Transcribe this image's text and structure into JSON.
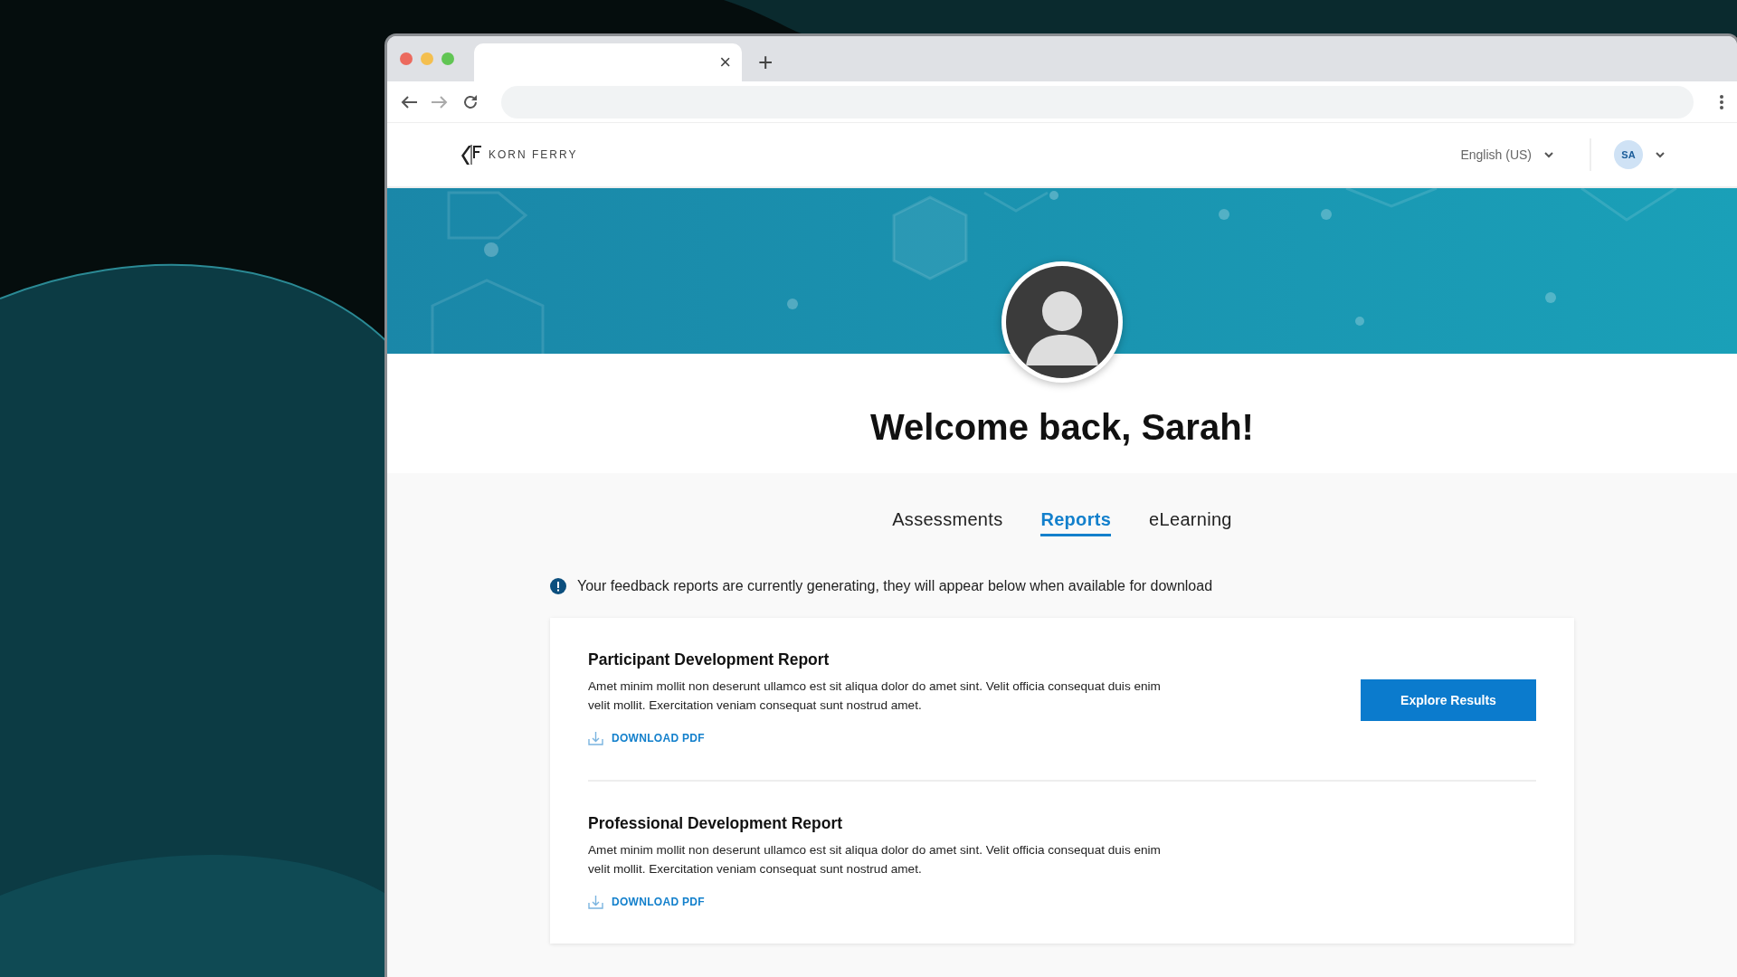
{
  "browser": {
    "tab_close": "×",
    "new_tab": "+"
  },
  "header": {
    "logo": "KORN FERRY",
    "language": "English (US)",
    "user_initials": "SA"
  },
  "welcome": "Welcome back, Sarah!",
  "tabs": [
    {
      "label": "Assessments",
      "selected": false
    },
    {
      "label": "Reports",
      "selected": true
    },
    {
      "label": "eLearning",
      "selected": false
    }
  ],
  "notice": "Your feedback reports are currently generating, they will appear below when available for download",
  "reports": [
    {
      "title": "Participant Development Report",
      "description": "Amet minim mollit non deserunt ullamco est sit aliqua dolor do amet sint. Velit officia consequat duis enim velit mollit. Exercitation veniam consequat sunt nostrud amet.",
      "download": "DOWNLOAD PDF",
      "button": "Explore Results"
    },
    {
      "title": "Professional Development Report",
      "description": "Amet minim mollit non deserunt ullamco est sit aliqua dolor do amet sint. Velit officia consequat duis enim velit mollit. Exercitation veniam consequat sunt nostrud amet.",
      "download": "DOWNLOAD PDF"
    }
  ]
}
